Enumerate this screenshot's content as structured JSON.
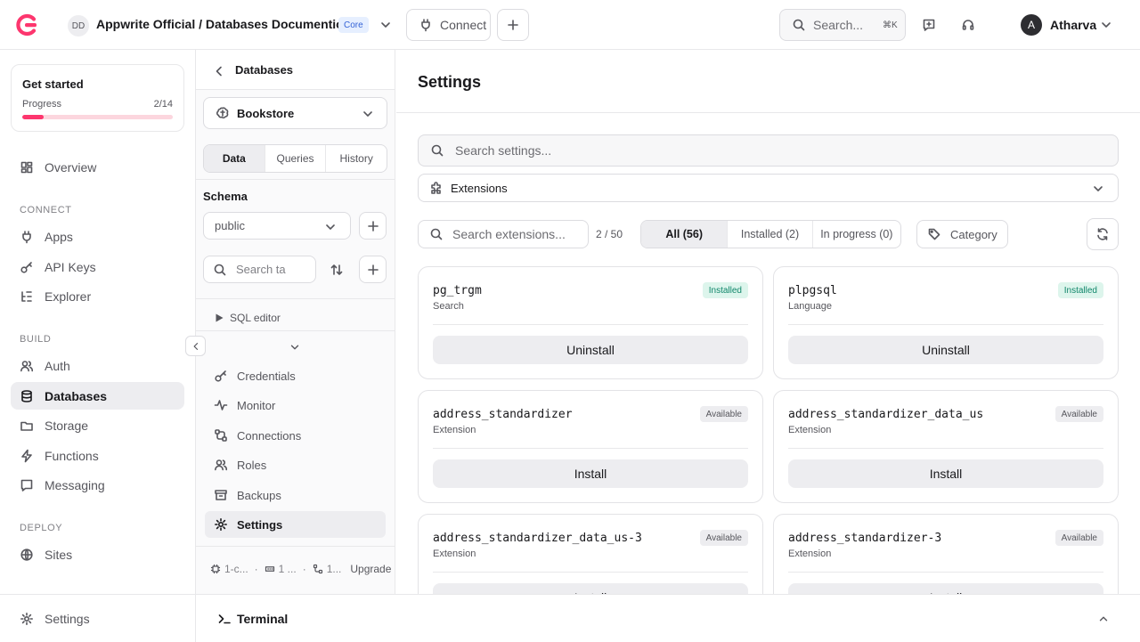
{
  "topbar": {
    "org_initials": "DD",
    "project_title": "Appwrite Official / Databases Documention",
    "plan_badge": "Core",
    "connect_label": "Connect",
    "search_placeholder": "Search...",
    "search_shortcut": "⌘K",
    "user_initial": "A",
    "user_name": "Atharva"
  },
  "sidebar": {
    "get_started": {
      "title": "Get started",
      "progress_label": "Progress",
      "progress_text": "2/14",
      "progress_fraction": 0.143
    },
    "overview": "Overview",
    "sections": {
      "connect": "CONNECT",
      "build": "BUILD",
      "deploy": "DEPLOY"
    },
    "connect_items": [
      "Apps",
      "API Keys",
      "Explorer"
    ],
    "build_items": [
      "Auth",
      "Databases",
      "Storage",
      "Functions",
      "Messaging"
    ],
    "deploy_items": [
      "Sites"
    ],
    "settings": "Settings"
  },
  "midpanel": {
    "title": "Databases",
    "database": "Bookstore",
    "tabs": [
      "Data",
      "Queries",
      "History"
    ],
    "schema_label": "Schema",
    "schema_value": "public",
    "table_search_placeholder": "Search ta",
    "sql_editor": "SQL editor",
    "nav": [
      "Credentials",
      "Monitor",
      "Connections",
      "Roles",
      "Backups",
      "Settings"
    ],
    "footer": {
      "item1": "1-c...",
      "item2": "1 ...",
      "item3": "1...",
      "upgrade": "Upgrade"
    }
  },
  "terminal": {
    "label": "Terminal"
  },
  "main": {
    "title": "Settings",
    "settings_search_placeholder": "Search settings...",
    "section_select": "Extensions",
    "ext_search_placeholder": "Search extensions...",
    "ext_count": "2 / 50",
    "filters": [
      "All (56)",
      "Installed (2)",
      "In progress (0)"
    ],
    "category_label": "Category",
    "extensions": [
      {
        "name": "pg_trgm",
        "category": "Search",
        "status": "Installed",
        "action": "Uninstall"
      },
      {
        "name": "plpgsql",
        "category": "Language",
        "status": "Installed",
        "action": "Uninstall"
      },
      {
        "name": "address_standardizer",
        "category": "Extension",
        "status": "Available",
        "action": "Install"
      },
      {
        "name": "address_standardizer_data_us",
        "category": "Extension",
        "status": "Available",
        "action": "Install"
      },
      {
        "name": "address_standardizer_data_us-3",
        "category": "Extension",
        "status": "Available",
        "action": "Install"
      },
      {
        "name": "address_standardizer-3",
        "category": "Extension",
        "status": "Available",
        "action": "Install"
      }
    ]
  },
  "colors": {
    "brand": "#fd366e",
    "installed_badge": "#10866a",
    "core_badge": "#3563d6"
  }
}
